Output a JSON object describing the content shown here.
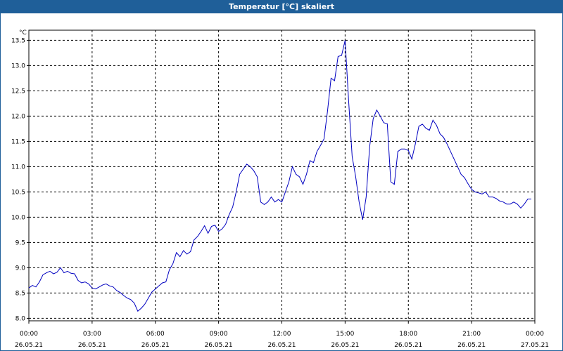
{
  "window": {
    "title": "Temperatur [°C] skaliert"
  },
  "colors": {
    "titlebar": "#1f5f99",
    "line": "#0000c0",
    "grid": "#000000"
  },
  "chart_data": {
    "type": "line",
    "title": "Temperatur [°C] skaliert",
    "ylabel": "°C",
    "ylim": [
      7.95,
      13.7
    ],
    "grid": true,
    "legend": "none",
    "yticks": [
      "8.0",
      "8.5",
      "9.0",
      "9.5",
      "10.0",
      "10.5",
      "11.0",
      "11.5",
      "12.0",
      "12.5",
      "13.0",
      "13.5"
    ],
    "xticks": [
      {
        "time": "00:00",
        "date": "26.05.21"
      },
      {
        "time": "03:00",
        "date": "26.05.21"
      },
      {
        "time": "06:00",
        "date": "26.05.21"
      },
      {
        "time": "09:00",
        "date": "26.05.21"
      },
      {
        "time": "12:00",
        "date": "26.05.21"
      },
      {
        "time": "15:00",
        "date": "26.05.21"
      },
      {
        "time": "18:00",
        "date": "26.05.21"
      },
      {
        "time": "21:00",
        "date": "26.05.21"
      },
      {
        "time": "00:00",
        "date": "27.05.21"
      }
    ],
    "xlim": [
      "26.05.21 00:00",
      "27.05.21 00:00"
    ],
    "series": [
      {
        "x": [
          "00:00",
          "00:10",
          "00:20",
          "00:30",
          "00:40",
          "00:50",
          "01:00",
          "01:10",
          "01:20",
          "01:30",
          "01:40",
          "01:50",
          "02:00",
          "02:10",
          "02:20",
          "02:30",
          "02:40",
          "02:50",
          "03:00",
          "03:10",
          "03:20",
          "03:30",
          "03:40",
          "03:50",
          "04:00",
          "04:10",
          "04:20",
          "04:30",
          "04:40",
          "04:50",
          "05:00",
          "05:10",
          "05:20",
          "05:30",
          "05:40",
          "05:50",
          "06:00",
          "06:10",
          "06:20",
          "06:30",
          "06:40",
          "06:50",
          "07:00",
          "07:10",
          "07:20",
          "07:30",
          "07:40",
          "07:50",
          "08:00",
          "08:10",
          "08:20",
          "08:30",
          "08:40",
          "08:50",
          "09:00",
          "09:10",
          "09:20",
          "09:30",
          "09:40",
          "09:50",
          "10:00",
          "10:10",
          "10:20",
          "10:30",
          "10:40",
          "10:50",
          "11:00",
          "11:10",
          "11:20",
          "11:30",
          "11:40",
          "11:50",
          "12:00",
          "12:10",
          "12:20",
          "12:30",
          "12:40",
          "12:50",
          "13:00",
          "13:10",
          "13:20",
          "13:30",
          "13:40",
          "13:50",
          "14:00",
          "14:10",
          "14:20",
          "14:30",
          "14:40",
          "14:50",
          "15:00",
          "15:10",
          "15:20",
          "15:30",
          "15:40",
          "15:50",
          "16:00",
          "16:10",
          "16:20",
          "16:30",
          "16:40",
          "16:50",
          "17:00",
          "17:10",
          "17:20",
          "17:30",
          "17:40",
          "17:50",
          "18:00",
          "18:10",
          "18:20",
          "18:30",
          "18:40",
          "18:50",
          "19:00",
          "19:10",
          "19:20",
          "19:30",
          "19:40",
          "19:50",
          "20:00",
          "20:10",
          "20:20",
          "20:30",
          "20:40",
          "20:50",
          "21:00",
          "21:10",
          "21:20",
          "21:30",
          "21:40",
          "21:50",
          "22:00",
          "22:10",
          "22:20",
          "22:30",
          "22:40",
          "22:50",
          "23:00",
          "23:10",
          "23:20",
          "23:30",
          "23:40",
          "23:50"
        ],
        "values": [
          8.6,
          8.65,
          8.62,
          8.72,
          8.86,
          8.9,
          8.93,
          8.88,
          8.91,
          9.0,
          8.9,
          8.93,
          8.89,
          8.88,
          8.75,
          8.7,
          8.72,
          8.68,
          8.6,
          8.58,
          8.62,
          8.66,
          8.68,
          8.64,
          8.62,
          8.55,
          8.51,
          8.45,
          8.4,
          8.37,
          8.3,
          8.14,
          8.2,
          8.28,
          8.4,
          8.52,
          8.58,
          8.64,
          8.7,
          8.72,
          8.96,
          9.08,
          9.3,
          9.22,
          9.34,
          9.27,
          9.32,
          9.55,
          9.62,
          9.72,
          9.83,
          9.68,
          9.82,
          9.84,
          9.72,
          9.77,
          9.86,
          10.05,
          10.2,
          10.5,
          10.85,
          10.95,
          11.05,
          11.0,
          10.92,
          10.8,
          10.3,
          10.25,
          10.3,
          10.4,
          10.3,
          10.35,
          10.3,
          10.5,
          10.7,
          11.0,
          10.85,
          10.8,
          10.65,
          10.85,
          11.12,
          11.08,
          11.3,
          11.42,
          11.55,
          12.1,
          12.75,
          12.7,
          13.18,
          13.2,
          13.5,
          12.3,
          11.2,
          10.8,
          10.3,
          9.95,
          10.4,
          11.4,
          11.95,
          12.12,
          12.0,
          11.87,
          11.85,
          10.7,
          10.65,
          11.3,
          11.35,
          11.35,
          11.32,
          11.15,
          11.45,
          11.8,
          11.84,
          11.76,
          11.72,
          11.92,
          11.82,
          11.65,
          11.58,
          11.45,
          11.3,
          11.15,
          11.0,
          10.85,
          10.78,
          10.66,
          10.55,
          10.5,
          10.48,
          10.46,
          10.5,
          10.4,
          10.4,
          10.37,
          10.32,
          10.3,
          10.26,
          10.26,
          10.3,
          10.26,
          10.18,
          10.26,
          10.36,
          10.36
        ]
      }
    ]
  }
}
